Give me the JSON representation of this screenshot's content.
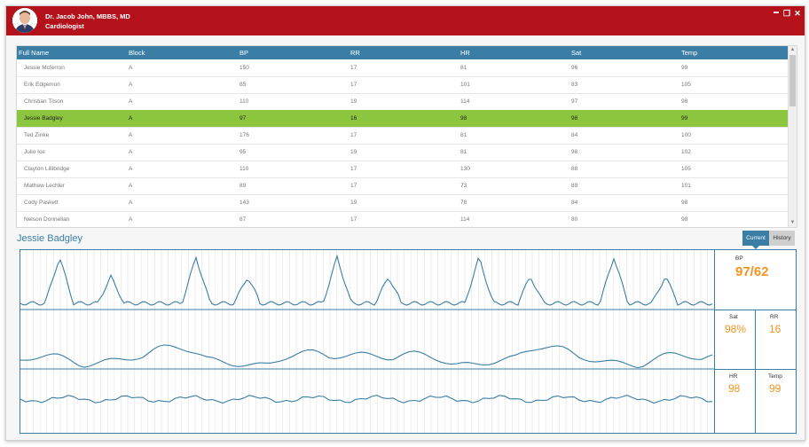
{
  "header": {
    "doctor_name": "Dr. Jacob John, MBBS, MD",
    "doctor_title": "Cardiologist",
    "window_controls": {
      "minimize": "▬",
      "restore": "❐",
      "close": "✕"
    },
    "brand_color": "#b3121a"
  },
  "table": {
    "columns": [
      "Full Name",
      "Block",
      "BP",
      "RR",
      "HR",
      "Sat",
      "Temp"
    ],
    "rows": [
      [
        "Jessie Mcferron",
        "A",
        "150",
        "17",
        "81",
        "96",
        "99"
      ],
      [
        "Erik Edgemon",
        "A",
        "85",
        "17",
        "101",
        "83",
        "105"
      ],
      [
        "Christian Tilson",
        "A",
        "110",
        "19",
        "114",
        "97",
        "98"
      ],
      [
        "Jessie Badgley",
        "A",
        "97",
        "16",
        "98",
        "98",
        "99"
      ],
      [
        "Ted Zinke",
        "A",
        "176",
        "17",
        "81",
        "84",
        "100"
      ],
      [
        "Julio Ice",
        "A",
        "95",
        "19",
        "81",
        "98",
        "102"
      ],
      [
        "Clayton Lillibridge",
        "A",
        "110",
        "17",
        "130",
        "88",
        "105"
      ],
      [
        "Mathew Lechler",
        "A",
        "89",
        "17",
        "73",
        "89",
        "101"
      ],
      [
        "Cody Paskett",
        "A",
        "143",
        "19",
        "78",
        "84",
        "98"
      ],
      [
        "Nelson Donnellan",
        "A",
        "87",
        "17",
        "114",
        "80",
        "98"
      ]
    ],
    "selected_row": "Jessie Badgley",
    "selected_color": "#8cc63f",
    "header_color": "#3a7ea6"
  },
  "scrollbar": {
    "up": "▲",
    "down": "▼"
  },
  "patient": {
    "name": "Jessie Badgley",
    "tabs": {
      "current": "Current",
      "history": "History"
    },
    "vitals": {
      "bp_label": "BP",
      "bp_value": "97/62",
      "sat_label": "Sat",
      "sat_value": "98%",
      "rr_label": "RR",
      "rr_value": "16",
      "hr_label": "HR",
      "hr_value": "98",
      "temp_label": "Temp",
      "temp_value": "99"
    },
    "value_color": "#f7941d"
  }
}
